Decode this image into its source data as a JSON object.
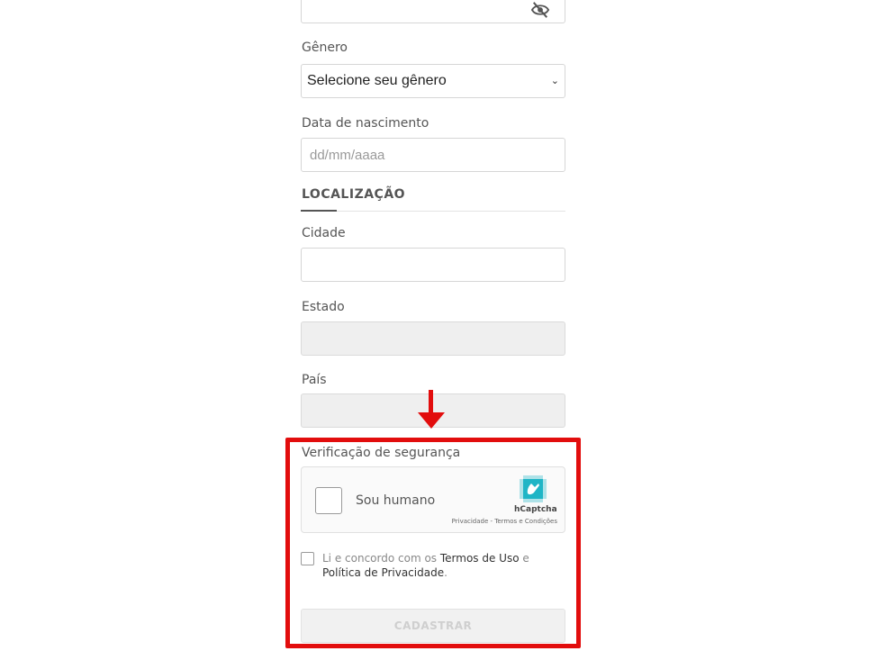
{
  "form": {
    "genero_label": "Gênero",
    "genero_selected": "Selecione seu gênero",
    "nascimento_label": "Data de nascimento",
    "nascimento_placeholder": "dd/mm/aaaa",
    "localizacao_title": "LOCALIZAÇÃO",
    "cidade_label": "Cidade",
    "estado_label": "Estado",
    "pais_label": "País",
    "verificacao_label": "Verificação de segurança"
  },
  "captcha": {
    "checkbox_text": "Sou humano",
    "brand": "hCaptcha",
    "links": "Privacidade - Termos e Condições"
  },
  "terms": {
    "prefix": "Li e concordo com os ",
    "termos_link": "Termos de Uso",
    "middle": " e ",
    "politica_link": "Política de Privacidade",
    "suffix": "."
  },
  "submit_label": "CADASTRAR",
  "colors": {
    "highlight": "#e20d0d",
    "hcaptcha_accent": "#1fb5c6"
  },
  "icons": {
    "password_toggle": "eye-slash-icon",
    "select_chevron": "chevron-down-icon",
    "annotation_arrow": "arrow-down-icon",
    "hcaptcha_logo": "hcaptcha-logo-icon"
  }
}
